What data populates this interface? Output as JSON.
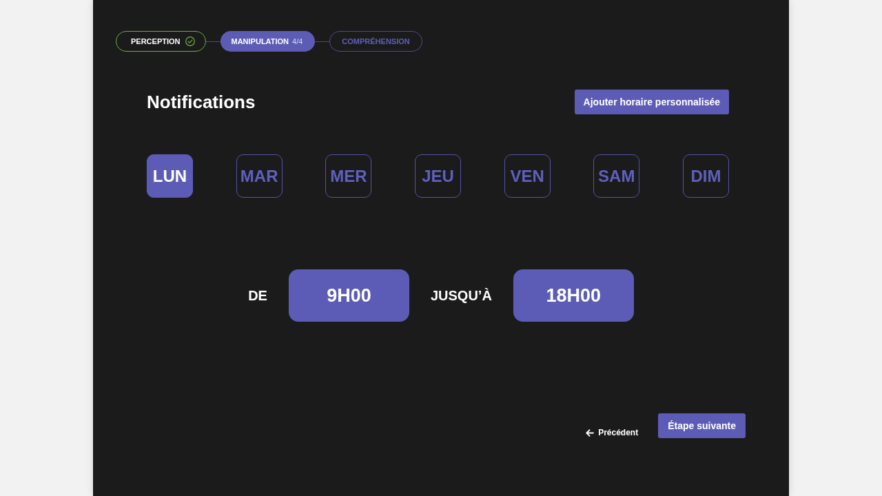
{
  "stepper": [
    {
      "label": "PERCEPTION",
      "completed": true,
      "selected": false
    },
    {
      "label": "MANIPULATION",
      "counter": "4/4",
      "completed": false,
      "selected": true
    },
    {
      "label": "COMPRÉHENSION",
      "completed": false,
      "selected": false
    }
  ],
  "header": {
    "title": "Notifications",
    "add_button": "Ajouter horaire personnalisée"
  },
  "days": [
    {
      "label": "LUN",
      "selected": true
    },
    {
      "label": "MAR",
      "selected": false
    },
    {
      "label": "MER",
      "selected": false
    },
    {
      "label": "JEU",
      "selected": false
    },
    {
      "label": "VEN",
      "selected": false
    },
    {
      "label": "SAM",
      "selected": false
    },
    {
      "label": "DIM",
      "selected": false
    }
  ],
  "time_range": {
    "from_label": "DE",
    "from_value": "9H00",
    "to_label": "JUSQU’À",
    "to_value": "18H00"
  },
  "footer": {
    "back_link": "Précédent",
    "next_button": "Étape suivante"
  }
}
